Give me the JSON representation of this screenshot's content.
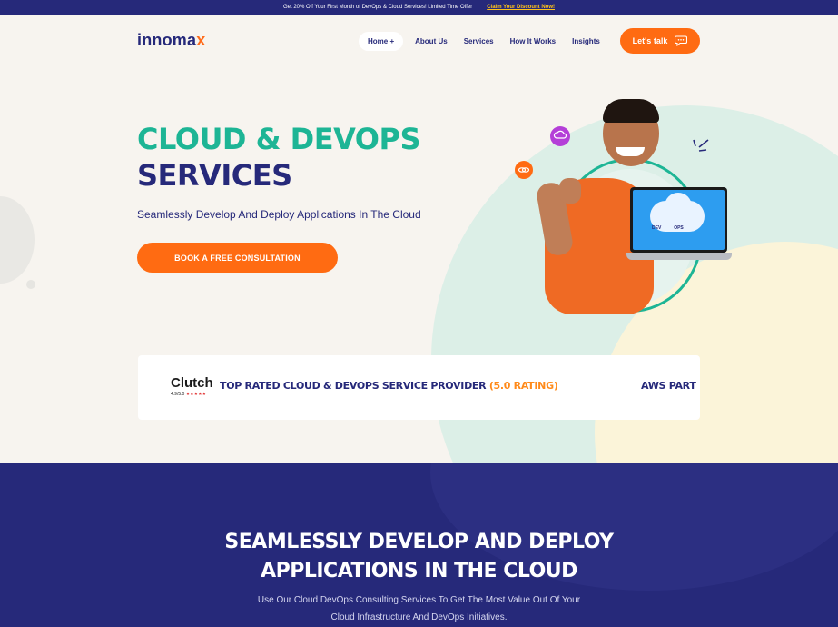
{
  "promo": {
    "text": "Get 20% Off Your First Month of DevOps & Cloud Services! Limited Time Offer",
    "cta": "Claim Your Discount Now!"
  },
  "brand": {
    "name_main": "innoma",
    "name_x": "x"
  },
  "nav": {
    "items": [
      "Home +",
      "About Us",
      "Services",
      "How It Works",
      "Insights"
    ],
    "cta": "Let's talk"
  },
  "hero": {
    "title_line1": "CLOUD & DEVOPS",
    "title_line2": "SERVICES",
    "subtitle": "Seamlessly Develop And Deploy Applications In The Cloud",
    "button": "BOOK A FREE CONSULTATION"
  },
  "illustration": {
    "dev": "DEV",
    "ops": "OPS"
  },
  "rating_strip": {
    "clutch_logo": "Clutch",
    "clutch_score": "4.9/5.0",
    "clutch_stars": "★★★★★",
    "text_main": "TOP RATED CLOUD & DEVOPS SERVICE PROVIDER ",
    "text_highlight": "(5.0 RATING)",
    "text_next": "AWS PART"
  },
  "section2": {
    "title_line1": "SEAMLESSLY DEVELOP AND DEPLOY",
    "title_line2": "APPLICATIONS IN THE CLOUD",
    "desc_line1": "Use Our Cloud DevOps Consulting Services To Get The Most Value Out Of Your",
    "desc_line2": "Cloud Infrastructure And DevOps Initiatives."
  },
  "colors": {
    "navy": "#26297a",
    "orange": "#ff6b12",
    "teal": "#1db595",
    "highlight": "#ff8a1a",
    "promo_link": "#ffc21a"
  }
}
